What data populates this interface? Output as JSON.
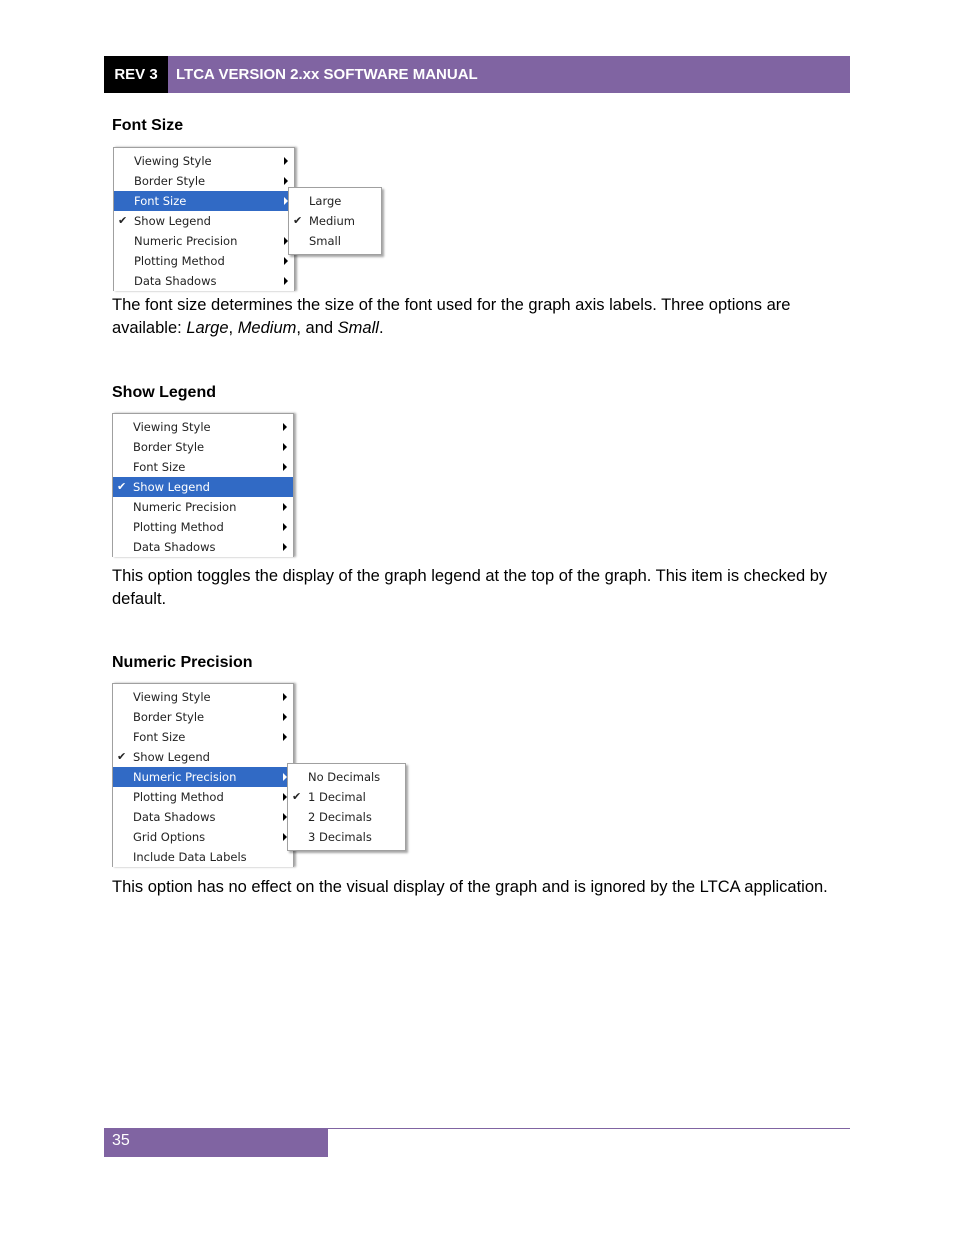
{
  "header": {
    "rev": "REV 3",
    "title": "LTCA VERSION 2.xx SOFTWARE MANUAL"
  },
  "colors": {
    "accent": "#8064a2",
    "menu_highlight": "#316ac5"
  },
  "sections": [
    {
      "heading": "Font Size",
      "menu": [
        {
          "label": "Viewing Style",
          "submenu": true
        },
        {
          "label": "Border Style",
          "submenu": true
        },
        {
          "label": "Font Size",
          "submenu": true,
          "selected": true
        },
        {
          "label": "Show Legend",
          "checked": true
        },
        {
          "label": "Numeric Precision",
          "submenu": true
        },
        {
          "label": "Plotting Method",
          "submenu": true
        },
        {
          "label": "Data Shadows",
          "submenu": true
        }
      ],
      "submenu": [
        {
          "label": "Large"
        },
        {
          "label": "Medium",
          "checked": true
        },
        {
          "label": "Small"
        }
      ],
      "para_1": "The font size determines the size of the font used for the graph axis labels. Three options are available: ",
      "para_opt1": "Large",
      "para_sep1": ", ",
      "para_opt2": "Medium",
      "para_sep2": ", and ",
      "para_opt3": "Small",
      "para_end": "."
    },
    {
      "heading": "Show Legend",
      "menu": [
        {
          "label": "Viewing Style",
          "submenu": true
        },
        {
          "label": "Border Style",
          "submenu": true
        },
        {
          "label": "Font Size",
          "submenu": true
        },
        {
          "label": "Show Legend",
          "checked": true,
          "selected": true
        },
        {
          "label": "Numeric Precision",
          "submenu": true
        },
        {
          "label": "Plotting Method",
          "submenu": true
        },
        {
          "label": "Data Shadows",
          "submenu": true
        }
      ],
      "para": "This option toggles the display of the graph legend at the top of the graph. This item is checked by default."
    },
    {
      "heading": "Numeric Precision",
      "menu": [
        {
          "label": "Viewing Style",
          "submenu": true
        },
        {
          "label": "Border Style",
          "submenu": true
        },
        {
          "label": "Font Size",
          "submenu": true
        },
        {
          "label": "Show Legend",
          "checked": true
        },
        {
          "label": "Numeric Precision",
          "submenu": true,
          "selected": true
        },
        {
          "label": "Plotting Method",
          "submenu": true
        },
        {
          "label": "Data Shadows",
          "submenu": true
        },
        {
          "label": "Grid Options",
          "submenu": true
        },
        {
          "label": "Include Data Labels"
        }
      ],
      "submenu": [
        {
          "label": "No Decimals"
        },
        {
          "label": "1 Decimal",
          "checked": true
        },
        {
          "label": "2 Decimals"
        },
        {
          "label": "3 Decimals"
        }
      ],
      "para": "This option has no effect on the visual display of the graph and is ignored by the LTCA application."
    }
  ],
  "icons": {
    "check": "✔",
    "submenu_arrow": "triangle-right"
  },
  "footer": {
    "page_number": "35"
  }
}
